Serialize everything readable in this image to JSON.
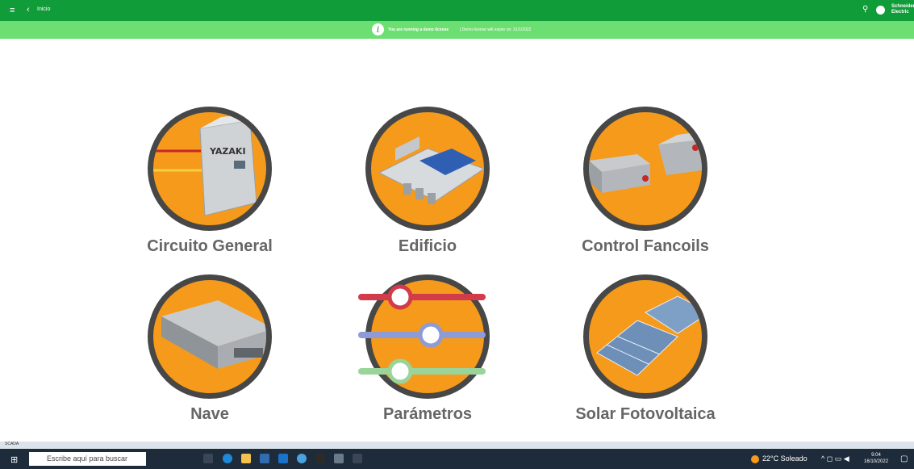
{
  "header": {
    "title": "Inicio",
    "brand": "Schneider Electric"
  },
  "banner": {
    "message": "You are running a demo license",
    "expiry": "| Demo license will expire on: 31/1/2022"
  },
  "tiles": [
    {
      "label": "Circuito General"
    },
    {
      "label": "Edificio"
    },
    {
      "label": "Control Fancoils"
    },
    {
      "label": "Nave"
    },
    {
      "label": "Parámetros"
    },
    {
      "label": "Solar Fotovoltaica"
    }
  ],
  "yazaki_text": "YAZAKI",
  "scada_label": "SCADA",
  "taskbar": {
    "search_placeholder": "Escribe aquí para buscar",
    "weather": "22°C Soleado",
    "time": "9:04",
    "date": "16/10/2022"
  },
  "colors": {
    "topbar": "#119c3a",
    "banner": "#6ddf72",
    "circle": "#f59a1b",
    "ring": "#474747"
  }
}
